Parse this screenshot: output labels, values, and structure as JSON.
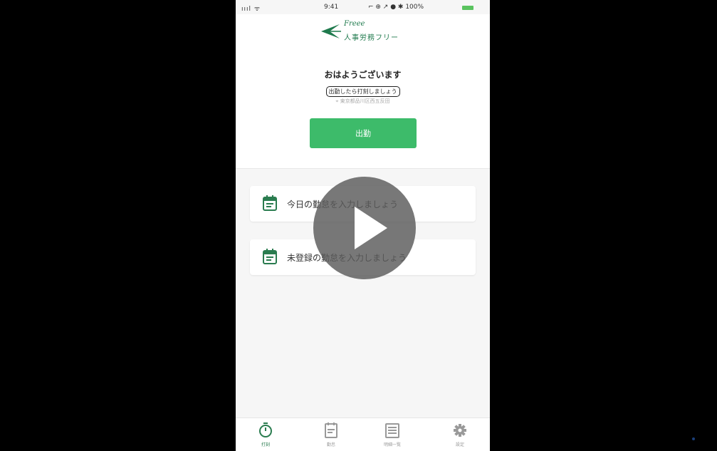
{
  "status_bar": {
    "signal": "ıııl ᯤ",
    "time": "9:41",
    "indicators": "⌐ ⊕ ↗ ● ✱ 100%",
    "battery_color": "#5ac35f"
  },
  "logo": {
    "script_text": "Freee",
    "text": "人事労務フリー"
  },
  "greeting": "おはようございます",
  "subtitle": "出勤したら打刻しましょう",
  "location": "⌖ 東京都品川区西五反田",
  "punch_button": {
    "label": "出勤",
    "color": "#3dbb6a"
  },
  "cards": [
    {
      "icon": "calendar-icon",
      "label": "今日の勤怠を入力しましょう"
    },
    {
      "icon": "calendar-icon",
      "label": "未登録の勤怠を入力しましょう"
    }
  ],
  "tabs": [
    {
      "icon": "stopwatch-icon",
      "label": "打刻",
      "active": true
    },
    {
      "icon": "document-icon",
      "label": "勤怠",
      "active": false
    },
    {
      "icon": "list-icon",
      "label": "明細一覧",
      "active": false
    },
    {
      "icon": "gear-icon",
      "label": "設定",
      "active": false
    }
  ],
  "accent_color": "#2a7c4f"
}
